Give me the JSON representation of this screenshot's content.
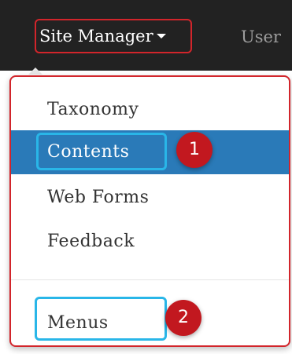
{
  "navbar": {
    "site_manager_label": "Site Manager",
    "user_label": "User"
  },
  "dropdown": {
    "items": [
      {
        "label": "Taxonomy",
        "active": false
      },
      {
        "label": "Contents",
        "active": true
      },
      {
        "label": "Web Forms",
        "active": false
      },
      {
        "label": "Feedback",
        "active": false
      },
      {
        "label": "Menus",
        "active": false
      }
    ]
  },
  "annotations": {
    "badge_1": "1",
    "badge_2": "2"
  },
  "colors": {
    "navbar_bg": "#222222",
    "active_bg": "#2a7ab8",
    "annotation_red": "#d2252b",
    "annotation_blue": "#29b6e8",
    "badge_red": "#c2181f"
  }
}
